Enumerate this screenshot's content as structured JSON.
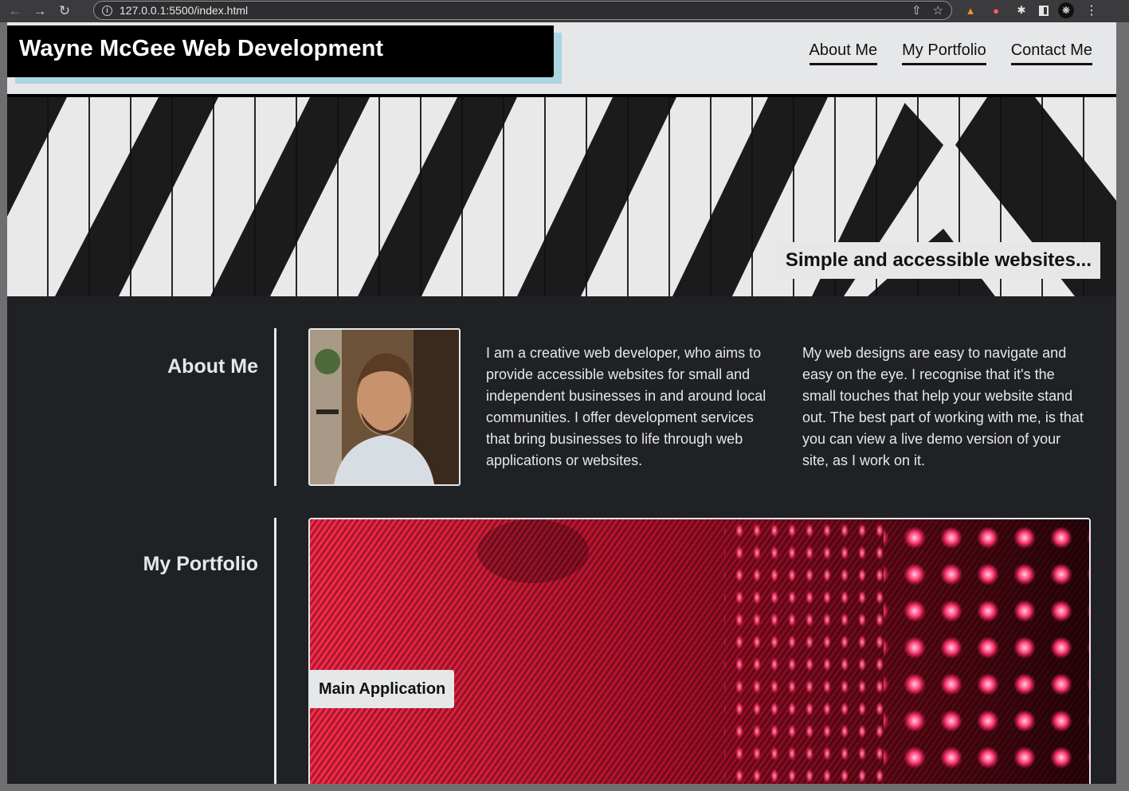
{
  "browser": {
    "url": "127.0.0.1:5500/index.html"
  },
  "header": {
    "title": "Wayne McGee Web Development",
    "nav": [
      {
        "label": "About Me"
      },
      {
        "label": "My Portfolio"
      },
      {
        "label": "Contact Me"
      }
    ]
  },
  "hero": {
    "tagline": "Simple and accessible websites..."
  },
  "about": {
    "heading": "About Me",
    "paragraph_1": "I am a creative web developer, who aims to provide accessible websites for small and independent businesses in and around local communities. I offer development services that bring businesses to life through web applications or websites.",
    "paragraph_2": "My web designs are easy to navigate and easy on the eye. I recognise that it's the small touches that help your website stand out. The best part of working with me, is that you can view a live demo version of your site, as I work on it."
  },
  "portfolio": {
    "heading": "My Portfolio",
    "main_label": "Main Application"
  },
  "colors": {
    "header_bg": "#e6e7e9",
    "logo_accent": "#abd6e1",
    "page_bg": "#202124",
    "led_red": "#ff2d55"
  }
}
